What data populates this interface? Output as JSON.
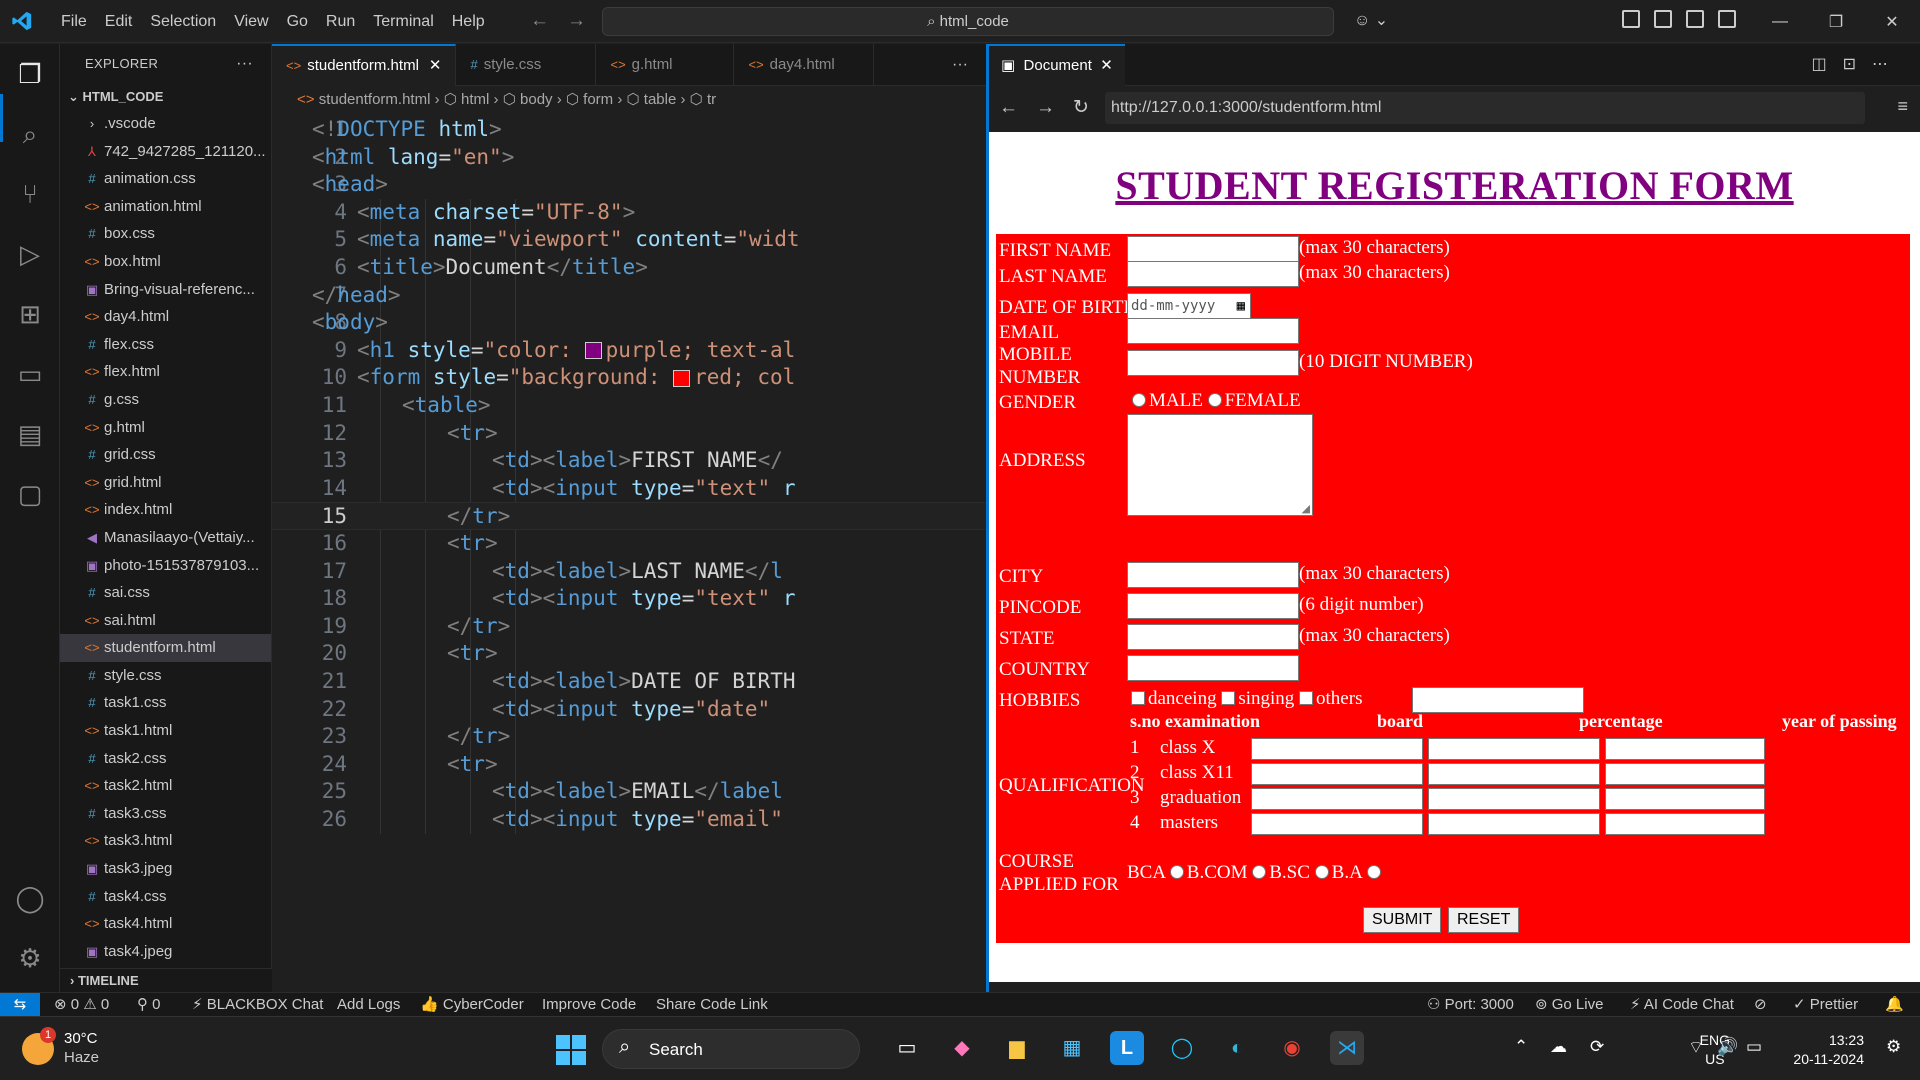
{
  "menu": [
    "File",
    "Edit",
    "Selection",
    "View",
    "Go",
    "Run",
    "Terminal",
    "Help"
  ],
  "command_center": "html_code",
  "explorer": {
    "title": "EXPLORER",
    "root": "HTML_CODE",
    "files": [
      {
        "name": ".vscode",
        "type": "folder"
      },
      {
        "name": "742_9427285_121120...",
        "type": "pdf"
      },
      {
        "name": "animation.css",
        "type": "css"
      },
      {
        "name": "animation.html",
        "type": "html"
      },
      {
        "name": "box.css",
        "type": "css"
      },
      {
        "name": "box.html",
        "type": "html"
      },
      {
        "name": "Bring-visual-referenc...",
        "type": "img"
      },
      {
        "name": "day4.html",
        "type": "html"
      },
      {
        "name": "flex.css",
        "type": "css"
      },
      {
        "name": "flex.html",
        "type": "html"
      },
      {
        "name": "g.css",
        "type": "css"
      },
      {
        "name": "g.html",
        "type": "html"
      },
      {
        "name": "grid.css",
        "type": "css"
      },
      {
        "name": "grid.html",
        "type": "html"
      },
      {
        "name": "index.html",
        "type": "html"
      },
      {
        "name": "Manasilaayo-(Vettaiy...",
        "type": "aud"
      },
      {
        "name": "photo-151537879103...",
        "type": "img"
      },
      {
        "name": "sai.css",
        "type": "css"
      },
      {
        "name": "sai.html",
        "type": "html"
      },
      {
        "name": "studentform.html",
        "type": "html",
        "selected": true
      },
      {
        "name": "style.css",
        "type": "css"
      },
      {
        "name": "task1.css",
        "type": "css"
      },
      {
        "name": "task1.html",
        "type": "html"
      },
      {
        "name": "task2.css",
        "type": "css"
      },
      {
        "name": "task2.html",
        "type": "html"
      },
      {
        "name": "task3.css",
        "type": "css"
      },
      {
        "name": "task3.html",
        "type": "html"
      },
      {
        "name": "task3.jpeg",
        "type": "img"
      },
      {
        "name": "task4.css",
        "type": "css"
      },
      {
        "name": "task4.html",
        "type": "html"
      },
      {
        "name": "task4.jpeg",
        "type": "img"
      }
    ],
    "timeline": "TIMELINE"
  },
  "editor": {
    "tabs": [
      {
        "label": "studentform.html",
        "icon": "html",
        "active": true
      },
      {
        "label": "style.css",
        "icon": "css"
      },
      {
        "label": "g.html",
        "icon": "html"
      },
      {
        "label": "day4.html",
        "icon": "html"
      }
    ],
    "breadcrumb": [
      "studentform.html",
      "html",
      "body",
      "form",
      "table",
      "tr"
    ],
    "current_line": 15,
    "lines": [
      {
        "n": 1,
        "i": 0,
        "t": [
          [
            "t",
            "<!"
          ],
          [
            "tn",
            "DOCTYPE"
          ],
          [
            "an",
            " html"
          ],
          [
            "t",
            ">"
          ]
        ]
      },
      {
        "n": 2,
        "i": 0,
        "t": [
          [
            "t",
            "<"
          ],
          [
            "tn",
            "html"
          ],
          [
            "an",
            " lang"
          ],
          [
            "tx",
            "="
          ],
          [
            "av",
            "\"en\""
          ],
          [
            "t",
            ">"
          ]
        ]
      },
      {
        "n": 3,
        "i": 0,
        "t": [
          [
            "t",
            "<"
          ],
          [
            "tn",
            "head"
          ],
          [
            "t",
            ">"
          ]
        ]
      },
      {
        "n": 4,
        "i": 1,
        "t": [
          [
            "t",
            "<"
          ],
          [
            "tn",
            "meta"
          ],
          [
            "an",
            " charset"
          ],
          [
            "tx",
            "="
          ],
          [
            "av",
            "\"UTF-8\""
          ],
          [
            "t",
            ">"
          ]
        ]
      },
      {
        "n": 5,
        "i": 1,
        "t": [
          [
            "t",
            "<"
          ],
          [
            "tn",
            "meta"
          ],
          [
            "an",
            " name"
          ],
          [
            "tx",
            "="
          ],
          [
            "av",
            "\"viewport\""
          ],
          [
            "an",
            " content"
          ],
          [
            "tx",
            "="
          ],
          [
            "av",
            "\"widt"
          ]
        ]
      },
      {
        "n": 6,
        "i": 1,
        "t": [
          [
            "t",
            "<"
          ],
          [
            "tn",
            "title"
          ],
          [
            "t",
            ">"
          ],
          [
            "tx",
            "Document"
          ],
          [
            "t",
            "</"
          ],
          [
            "tn",
            "title"
          ],
          [
            "t",
            ">"
          ]
        ]
      },
      {
        "n": 7,
        "i": 0,
        "t": [
          [
            "t",
            "</"
          ],
          [
            "tn",
            "head"
          ],
          [
            "t",
            ">"
          ]
        ]
      },
      {
        "n": 8,
        "i": 0,
        "t": [
          [
            "t",
            "<"
          ],
          [
            "tn",
            "body"
          ],
          [
            "t",
            ">"
          ]
        ]
      },
      {
        "n": 9,
        "i": 1,
        "t": [
          [
            "t",
            "<"
          ],
          [
            "tn",
            "h1"
          ],
          [
            "an",
            " style"
          ],
          [
            "tx",
            "="
          ],
          [
            "av",
            "\"color: "
          ],
          [
            "swatch",
            "#800080"
          ],
          [
            "av",
            "purple; text-al"
          ]
        ]
      },
      {
        "n": 10,
        "i": 1,
        "t": [
          [
            "t",
            "<"
          ],
          [
            "tn",
            "form"
          ],
          [
            "an",
            " style"
          ],
          [
            "tx",
            "="
          ],
          [
            "av",
            "\"background: "
          ],
          [
            "swatch",
            "#ff0000"
          ],
          [
            "av",
            "red; col"
          ]
        ]
      },
      {
        "n": 11,
        "i": 2,
        "t": [
          [
            "t",
            "<"
          ],
          [
            "tn",
            "table"
          ],
          [
            "t",
            ">"
          ]
        ]
      },
      {
        "n": 12,
        "i": 3,
        "t": [
          [
            "t",
            "<"
          ],
          [
            "tn",
            "tr"
          ],
          [
            "t",
            ">"
          ]
        ]
      },
      {
        "n": 13,
        "i": 4,
        "t": [
          [
            "t",
            "<"
          ],
          [
            "tn",
            "td"
          ],
          [
            "t",
            "><"
          ],
          [
            "tn",
            "label"
          ],
          [
            "t",
            ">"
          ],
          [
            "tx",
            "FIRST NAME"
          ],
          [
            "t",
            "</"
          ]
        ]
      },
      {
        "n": 14,
        "i": 4,
        "t": [
          [
            "t",
            "<"
          ],
          [
            "tn",
            "td"
          ],
          [
            "t",
            "><"
          ],
          [
            "tn",
            "input"
          ],
          [
            "an",
            " type"
          ],
          [
            "tx",
            "="
          ],
          [
            "av",
            "\"text\""
          ],
          [
            "an",
            " r"
          ]
        ]
      },
      {
        "n": 15,
        "i": 3,
        "t": [
          [
            "t",
            "</"
          ],
          [
            "tn",
            "tr"
          ],
          [
            "t",
            ">"
          ]
        ]
      },
      {
        "n": 16,
        "i": 3,
        "t": [
          [
            "t",
            "<"
          ],
          [
            "tn",
            "tr"
          ],
          [
            "t",
            ">"
          ]
        ]
      },
      {
        "n": 17,
        "i": 4,
        "t": [
          [
            "t",
            "<"
          ],
          [
            "tn",
            "td"
          ],
          [
            "t",
            "><"
          ],
          [
            "tn",
            "label"
          ],
          [
            "t",
            ">"
          ],
          [
            "tx",
            "LAST NAME"
          ],
          [
            "t",
            "</"
          ],
          [
            "tn",
            "l"
          ]
        ]
      },
      {
        "n": 18,
        "i": 4,
        "t": [
          [
            "t",
            "<"
          ],
          [
            "tn",
            "td"
          ],
          [
            "t",
            "><"
          ],
          [
            "tn",
            "input"
          ],
          [
            "an",
            " type"
          ],
          [
            "tx",
            "="
          ],
          [
            "av",
            "\"text\""
          ],
          [
            "an",
            " r"
          ]
        ]
      },
      {
        "n": 19,
        "i": 3,
        "t": [
          [
            "t",
            "</"
          ],
          [
            "tn",
            "tr"
          ],
          [
            "t",
            ">"
          ]
        ]
      },
      {
        "n": 20,
        "i": 3,
        "t": [
          [
            "t",
            "<"
          ],
          [
            "tn",
            "tr"
          ],
          [
            "t",
            ">"
          ]
        ]
      },
      {
        "n": 21,
        "i": 4,
        "t": [
          [
            "t",
            "<"
          ],
          [
            "tn",
            "td"
          ],
          [
            "t",
            "><"
          ],
          [
            "tn",
            "label"
          ],
          [
            "t",
            ">"
          ],
          [
            "tx",
            "DATE OF BIRTH"
          ]
        ]
      },
      {
        "n": 22,
        "i": 4,
        "t": [
          [
            "t",
            "<"
          ],
          [
            "tn",
            "td"
          ],
          [
            "t",
            "><"
          ],
          [
            "tn",
            "input"
          ],
          [
            "an",
            " type"
          ],
          [
            "tx",
            "="
          ],
          [
            "av",
            "\"date\""
          ]
        ]
      },
      {
        "n": 23,
        "i": 3,
        "t": [
          [
            "t",
            "</"
          ],
          [
            "tn",
            "tr"
          ],
          [
            "t",
            ">"
          ]
        ]
      },
      {
        "n": 24,
        "i": 3,
        "t": [
          [
            "t",
            "<"
          ],
          [
            "tn",
            "tr"
          ],
          [
            "t",
            ">"
          ]
        ]
      },
      {
        "n": 25,
        "i": 4,
        "t": [
          [
            "t",
            "<"
          ],
          [
            "tn",
            "td"
          ],
          [
            "t",
            "><"
          ],
          [
            "tn",
            "label"
          ],
          [
            "t",
            ">"
          ],
          [
            "tx",
            "EMAIL"
          ],
          [
            "t",
            "</"
          ],
          [
            "tn",
            "label"
          ]
        ]
      },
      {
        "n": 26,
        "i": 4,
        "t": [
          [
            "t",
            "<"
          ],
          [
            "tn",
            "td"
          ],
          [
            "t",
            "><"
          ],
          [
            "tn",
            "input"
          ],
          [
            "an",
            " type"
          ],
          [
            "tx",
            "="
          ],
          [
            "av",
            "\"email\""
          ]
        ]
      }
    ]
  },
  "preview": {
    "tab_label": "Document",
    "url": "http://127.0.0.1:3000/studentform.html",
    "heading": "STUDENT REGISTERATION FORM",
    "heading_color": "#800080",
    "form_bg": "#ff0000",
    "labels": {
      "first_name": "FIRST NAME",
      "last_name": "LAST NAME",
      "dob": "DATE OF BIRTH",
      "email": "EMAIL",
      "mobile_1": "MOBILE",
      "mobile_2": "NUMBER",
      "gender": "GENDER",
      "address": "ADDRESS",
      "city": "CITY",
      "pincode": "PINCODE",
      "state": "STATE",
      "country": "COUNTRY",
      "hobbies": "HOBBIES",
      "qualification": "QUALIFICATION",
      "course_1": "COURSE",
      "course_2": "APPLIED FOR"
    },
    "notes": {
      "first_name": "(max 30 characters)",
      "last_name": "(max 30 characters)",
      "mobile": "(10 DIGIT NUMBER)",
      "city": "(max 30 characters)",
      "pincode": "(6 digit number)",
      "state": "(max 30 characters)"
    },
    "dob_placeholder": "dd-mm-yyyy",
    "gender_options": [
      "MALE",
      "FEMALE"
    ],
    "hobbies": [
      "danceing",
      "singing",
      "others"
    ],
    "qual_headers": [
      "s.no",
      "examination",
      "board",
      "percentage",
      "year of passing"
    ],
    "qual_rows": [
      {
        "sno": "1",
        "exam": "class X"
      },
      {
        "sno": "2",
        "exam": "class X11"
      },
      {
        "sno": "3",
        "exam": "graduation"
      },
      {
        "sno": "4",
        "exam": "masters"
      }
    ],
    "courses": [
      "BCA",
      "B.COM",
      "B.SC",
      "B.A"
    ],
    "submit": "SUBMIT",
    "reset": "RESET"
  },
  "statusbar": {
    "errors": "0",
    "warnings": "0",
    "ports": "0",
    "left_items": [
      "BLACKBOX Chat",
      "Add Logs",
      "CyberCoder",
      "Improve Code",
      "Share Code Link"
    ],
    "port": "Port: 3000",
    "golive": "Go Live",
    "aichat": "AI Code Chat",
    "prettier": "Prettier"
  },
  "taskbar": {
    "temp": "30°C",
    "weather": "Haze",
    "weather_badge": "1",
    "search": "Search",
    "lang_1": "ENG",
    "lang_2": "US",
    "time": "13:23",
    "date": "20-11-2024"
  }
}
